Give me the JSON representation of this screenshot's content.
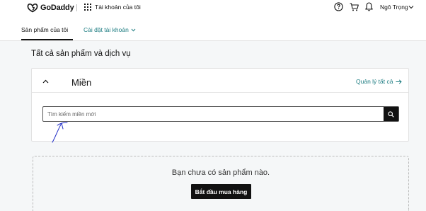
{
  "header": {
    "brand": "GoDaddy",
    "account_title": "Tài khoản của tôi",
    "user_name": "Ngô Trọng",
    "icons": [
      "godaddy-logo-icon",
      "apps-grid-icon",
      "help-icon",
      "cart-icon",
      "bell-icon",
      "chevron-down-icon"
    ]
  },
  "subnav": {
    "tabs": [
      {
        "label": "Sản phẩm của tôi",
        "active": true
      },
      {
        "label": "Cài đặt tài khoản",
        "active": false
      }
    ]
  },
  "main": {
    "title": "Tất cả sản phẩm và dịch vụ",
    "domain_card": {
      "title": "Miền",
      "manage_link": "Quản lý tất cả",
      "search_placeholder": "Tìm kiếm miền mới"
    },
    "empty_state": {
      "message": "Bạn chưa có sản phẩm nào.",
      "button_label": "Bắt đầu mua hàng"
    }
  },
  "colors": {
    "accent_link": "#1b7b80",
    "button_bg": "#111111",
    "page_bg": "#f5f7f8",
    "annotation_ink": "#2430c8"
  }
}
